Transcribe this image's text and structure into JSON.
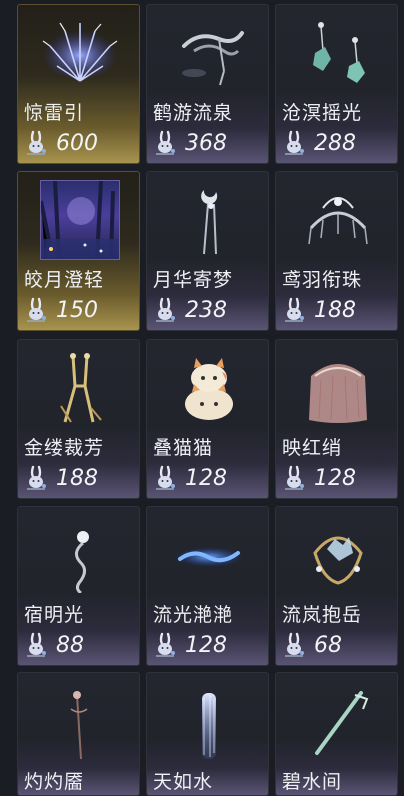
{
  "items": [
    {
      "name": "惊雷引",
      "price": "600",
      "art": "lightning-crest-icon",
      "tier": "gold"
    },
    {
      "name": "鹤游流泉",
      "price": "368",
      "art": "crane-stream-icon",
      "tier": "normal"
    },
    {
      "name": "沧溟摇光",
      "price": "288",
      "art": "jade-earrings-icon",
      "tier": "normal"
    },
    {
      "name": "皎月澄轻",
      "price": "150",
      "art": "moonlit-forest-scene-icon",
      "tier": "gold"
    },
    {
      "name": "月华寄梦",
      "price": "238",
      "art": "moon-hairpin-icon",
      "tier": "normal"
    },
    {
      "name": "鸢羽衔珠",
      "price": "188",
      "art": "kite-feather-crown-icon",
      "tier": "normal"
    },
    {
      "name": "金缕裁芳",
      "price": "188",
      "art": "golden-tassel-icon",
      "tier": "normal"
    },
    {
      "name": "叠猫猫",
      "price": "128",
      "art": "stacked-cats-icon",
      "tier": "normal"
    },
    {
      "name": "映红绡",
      "price": "128",
      "art": "red-veil-icon",
      "tier": "normal"
    },
    {
      "name": "宿明光",
      "price": "88",
      "art": "pearl-pendant-icon",
      "tier": "normal"
    },
    {
      "name": "流光滟滟",
      "price": "128",
      "art": "blue-flame-icon",
      "tier": "normal"
    },
    {
      "name": "流岚抱岳",
      "price": "68",
      "art": "crystal-wreath-icon",
      "tier": "normal"
    },
    {
      "name": "灼灼靥",
      "price": "",
      "art": "flower-hairpin-icon",
      "tier": "normal"
    },
    {
      "name": "天如水",
      "price": "",
      "art": "waterfall-icon",
      "tier": "normal"
    },
    {
      "name": "碧水间",
      "price": "",
      "art": "jade-hairpin-icon",
      "tier": "normal"
    }
  ],
  "currency_icon": "rabbit-currency-icon",
  "colors": {
    "gold_glow": "#a8944e",
    "purple_glow": "#5a5474",
    "background": "#1b1d24"
  }
}
